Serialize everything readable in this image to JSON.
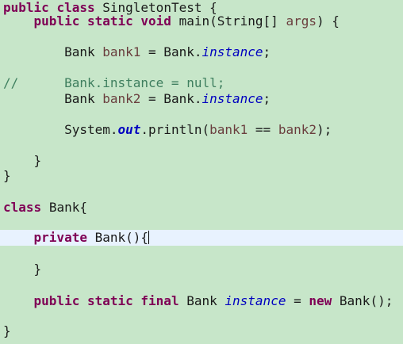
{
  "code": {
    "line1": {
      "kw1": "public",
      "kw2": "class",
      "name": "SingletonTest {"
    },
    "line2": {
      "kw1": "public",
      "kw2": "static",
      "kw3": "void",
      "sig": "main(String[]",
      "param": "args",
      "tail": ") {"
    },
    "line3": {
      "type": "Bank",
      "var": "bank1",
      "eq": " = Bank.",
      "field": "instance",
      "semi": ";"
    },
    "line4": {
      "comment_mark": "//",
      "comment_text": "Bank.instance = null;"
    },
    "line5": {
      "type": "Bank",
      "var": "bank2",
      "eq": " = Bank.",
      "field": "instance",
      "semi": ";"
    },
    "line6": {
      "sys": "System.",
      "out": "out",
      "print": ".println(",
      "a": "bank1",
      "op": " == ",
      "b": "bank2",
      "tail": ");"
    },
    "line7": {
      "brace": "}"
    },
    "line8": {
      "brace": "}"
    },
    "line9": {
      "kw": "class",
      "rest": "Bank{"
    },
    "line10": {
      "kw": "private",
      "rest": "Bank(){"
    },
    "line11": {
      "brace": "}"
    },
    "line12": {
      "kw1": "public",
      "kw2": "static",
      "kw3": "final",
      "type": "Bank",
      "field": "instance",
      "eq": " = ",
      "kw4": "new",
      "tail": "Bank();"
    },
    "line13": {
      "brace": "}"
    }
  }
}
